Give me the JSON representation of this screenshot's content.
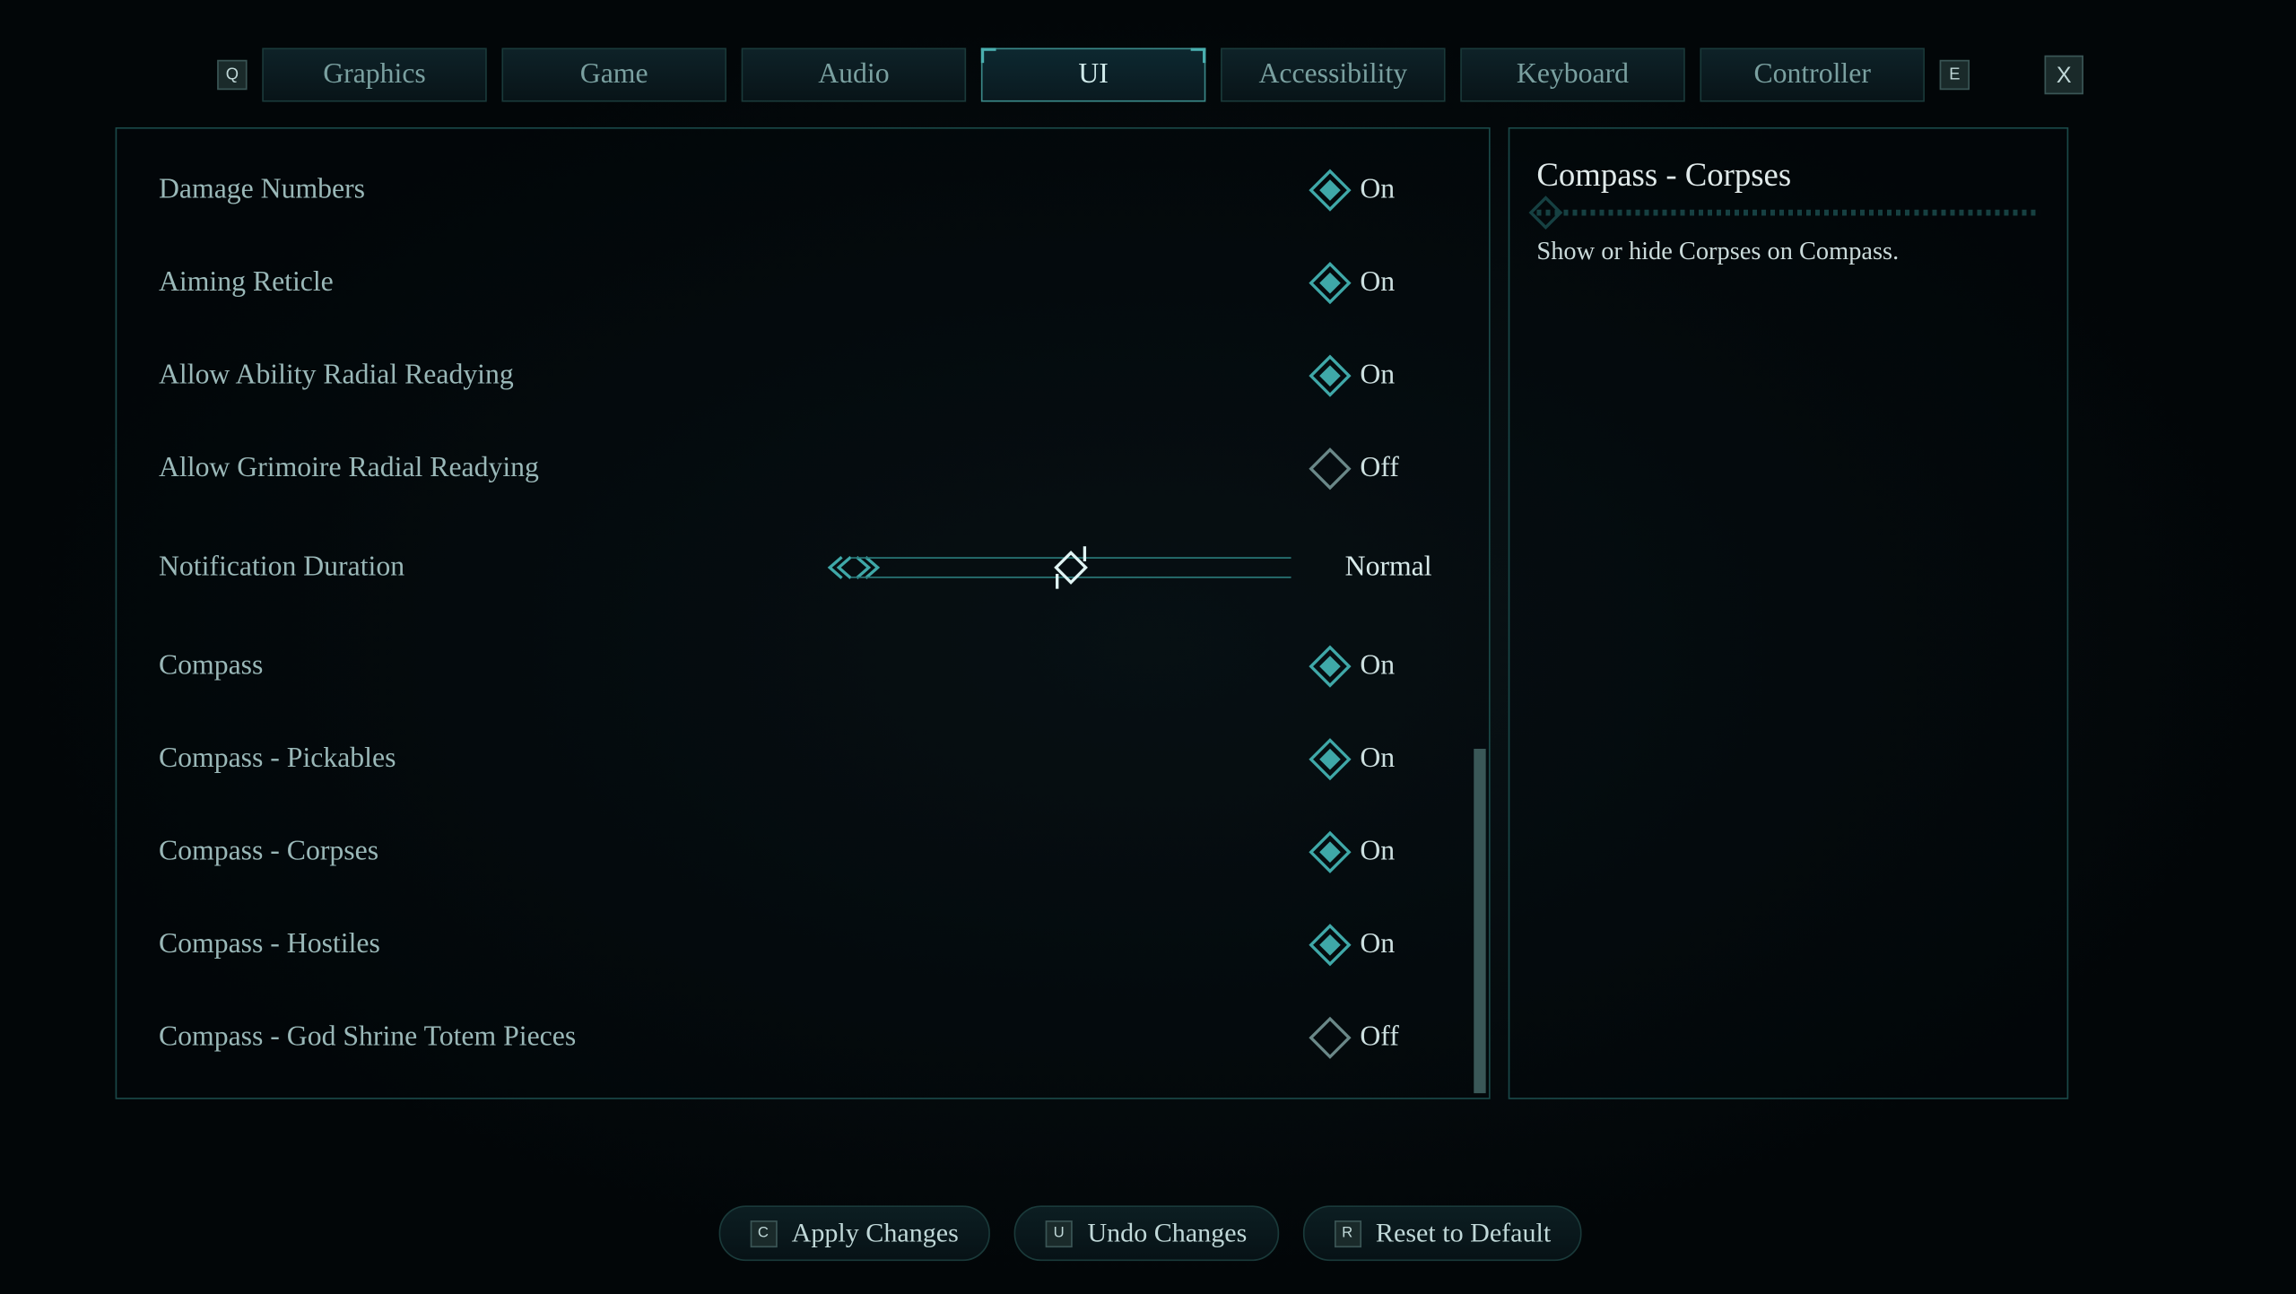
{
  "nav": {
    "prev_key": "Q",
    "next_key": "E",
    "close": "X",
    "tabs": [
      {
        "label": "Graphics",
        "active": false
      },
      {
        "label": "Game",
        "active": false
      },
      {
        "label": "Audio",
        "active": false
      },
      {
        "label": "UI",
        "active": true
      },
      {
        "label": "Accessibility",
        "active": false
      },
      {
        "label": "Keyboard",
        "active": false
      },
      {
        "label": "Controller",
        "active": false
      }
    ]
  },
  "options": [
    {
      "label": "Damage Numbers",
      "type": "toggle",
      "value": "On"
    },
    {
      "label": "Aiming Reticle",
      "type": "toggle",
      "value": "On"
    },
    {
      "label": "Allow Ability Radial Readying",
      "type": "toggle",
      "value": "On"
    },
    {
      "label": "Allow Grimoire Radial Readying",
      "type": "toggle",
      "value": "Off"
    },
    {
      "label": "Notification Duration",
      "type": "slider",
      "value": "Normal"
    },
    {
      "label": "Compass",
      "type": "toggle",
      "value": "On"
    },
    {
      "label": "Compass - Pickables",
      "type": "toggle",
      "value": "On"
    },
    {
      "label": "Compass - Corpses",
      "type": "toggle",
      "value": "On"
    },
    {
      "label": "Compass - Hostiles",
      "type": "toggle",
      "value": "On"
    },
    {
      "label": "Compass - God Shrine Totem Pieces",
      "type": "toggle",
      "value": "Off"
    }
  ],
  "description": {
    "title": "Compass - Corpses",
    "body": "Show or hide Corpses on Compass."
  },
  "footer": {
    "apply": {
      "key": "C",
      "label": "Apply Changes"
    },
    "undo": {
      "key": "U",
      "label": "Undo Changes"
    },
    "reset": {
      "key": "R",
      "label": "Reset to Default"
    }
  }
}
